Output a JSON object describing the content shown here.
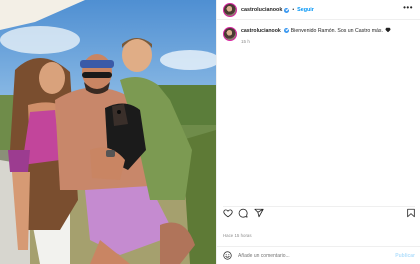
{
  "post": {
    "username": "castrolucianook",
    "follow_label": "Seguir",
    "separator": "•",
    "more_label": "•••",
    "caption_text": "Bienvenido Ramón. Sos un Castro más.",
    "caption_time": "15 h",
    "likes_time": "Hace 15 horas",
    "comment_placeholder": "Añade un comentario...",
    "publish_label": "Publicar"
  },
  "colors": {
    "accent": "#0095f6",
    "verified": "#3897f0",
    "muted": "#8e8e8e",
    "publish_disabled": "#b2dffc"
  },
  "icons": [
    "heart-icon",
    "comment-icon",
    "share-icon",
    "bookmark-icon",
    "emoji-icon",
    "verified-icon"
  ]
}
